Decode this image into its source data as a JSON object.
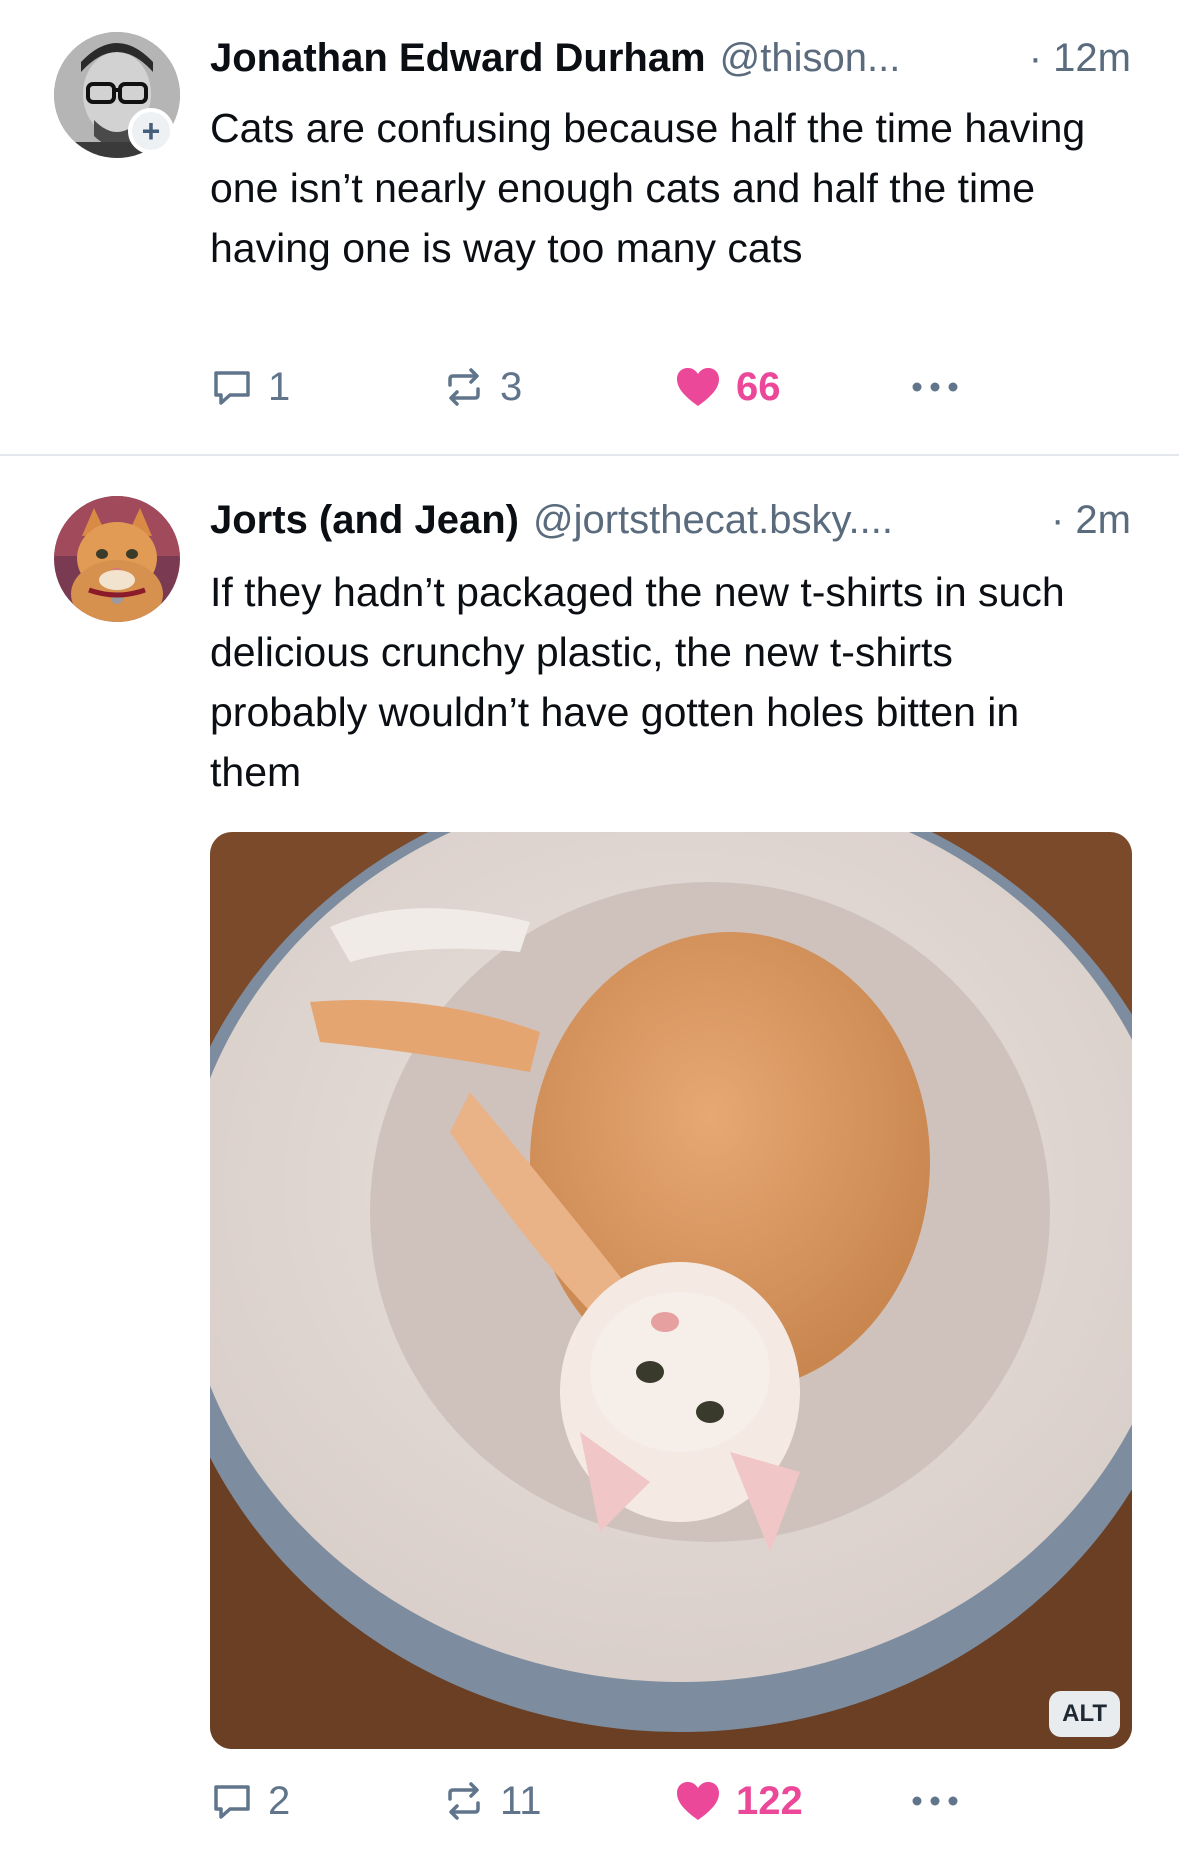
{
  "posts": [
    {
      "author_name": "Jonathan Edward Durham",
      "handle": "@thison...",
      "time": "· 12m",
      "text": "Cats are confusing because half the time having one isn’t nearly enough cats and half the time having one is way too many cats",
      "reply_count": "1",
      "repost_count": "3",
      "like_count": "66",
      "liked": true,
      "follow_badge": "+"
    },
    {
      "author_name": "Jorts (and Jean)",
      "handle": "@jortsthecat.bsky....",
      "time": "· 2m",
      "text": "If they hadn’t packaged the new t-shirts in such delicious crunchy plastic, the new t-shirts probably wouldn’t have gotten holes bitten in them",
      "image_alt_badge": "ALT",
      "reply_count": "2",
      "repost_count": "11",
      "like_count": "122",
      "liked": true
    }
  ],
  "icons": {
    "reply": "speech-bubble-icon",
    "repost": "repost-arrows-icon",
    "like": "heart-icon",
    "more": "more-horizontal-icon"
  },
  "colors": {
    "like_accent": "#ec4899",
    "muted": "#60758b",
    "text": "#0b0f14",
    "divider": "#e4e7ec"
  }
}
